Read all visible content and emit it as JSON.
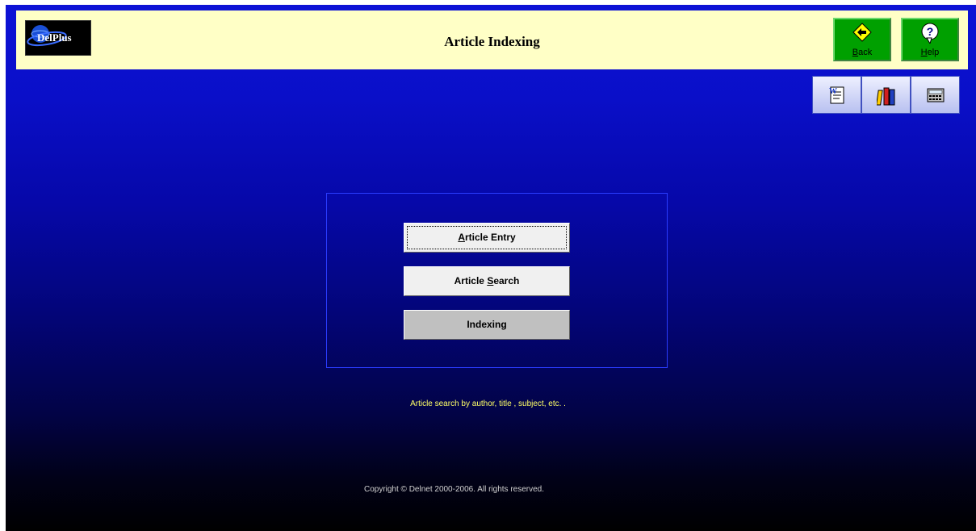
{
  "header": {
    "logo_text": "DelPlus",
    "title": "Article Indexing",
    "back": {
      "label_accel": "B",
      "label_rest": "ack",
      "icon": "back-arrow-icon"
    },
    "help": {
      "label_accel": "H",
      "label_rest": "elp",
      "icon": "question-icon"
    }
  },
  "toolbar": [
    {
      "name": "word-document-icon"
    },
    {
      "name": "books-icon"
    },
    {
      "name": "calculator-icon"
    }
  ],
  "menu": {
    "article_entry": {
      "accel": "A",
      "rest": "rticle Entry"
    },
    "article_search": {
      "pre": "Article ",
      "accel": "S",
      "rest": "earch"
    },
    "indexing": "Indexing"
  },
  "status_text": "Article search by author, title , subject, etc. .",
  "footer_text": "Copyright © Delnet 2000-2006. All rights reserved.",
  "colors": {
    "header_bg": "#ffffc6",
    "header_button": "#00a000",
    "status_text": "#ffff66"
  }
}
